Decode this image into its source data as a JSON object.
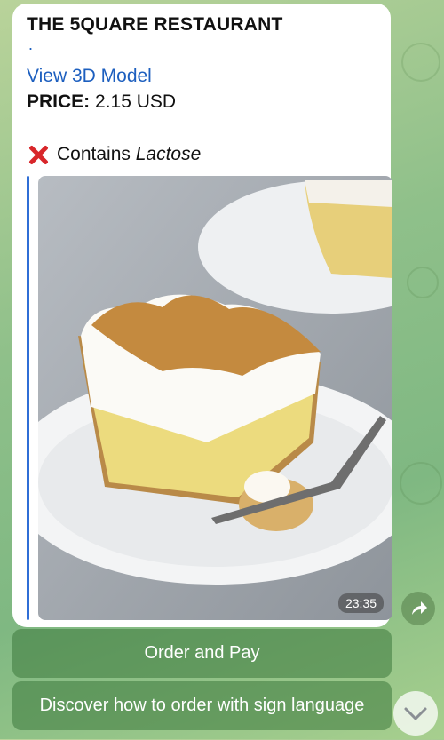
{
  "message": {
    "title": "THE 5QUARE RESTAURANT",
    "dot": ".",
    "link_label": "View 3D Model",
    "price_label": "PRICE:",
    "price_value": "2.15 USD",
    "allergen_prefix": "Contains",
    "allergen_name": "Lactose",
    "allergen_icon": "cross-mark-icon",
    "video_duration": "23:35"
  },
  "keyboard": {
    "buttons": [
      "Order and Pay",
      "Discover how to order with sign language"
    ]
  },
  "icons": {
    "share": "share-arrow-icon",
    "scroll": "chevron-down-icon"
  },
  "colors": {
    "link": "#1d5fbf",
    "quote_bar": "#2f6ed6",
    "cross": "#d8262a"
  }
}
